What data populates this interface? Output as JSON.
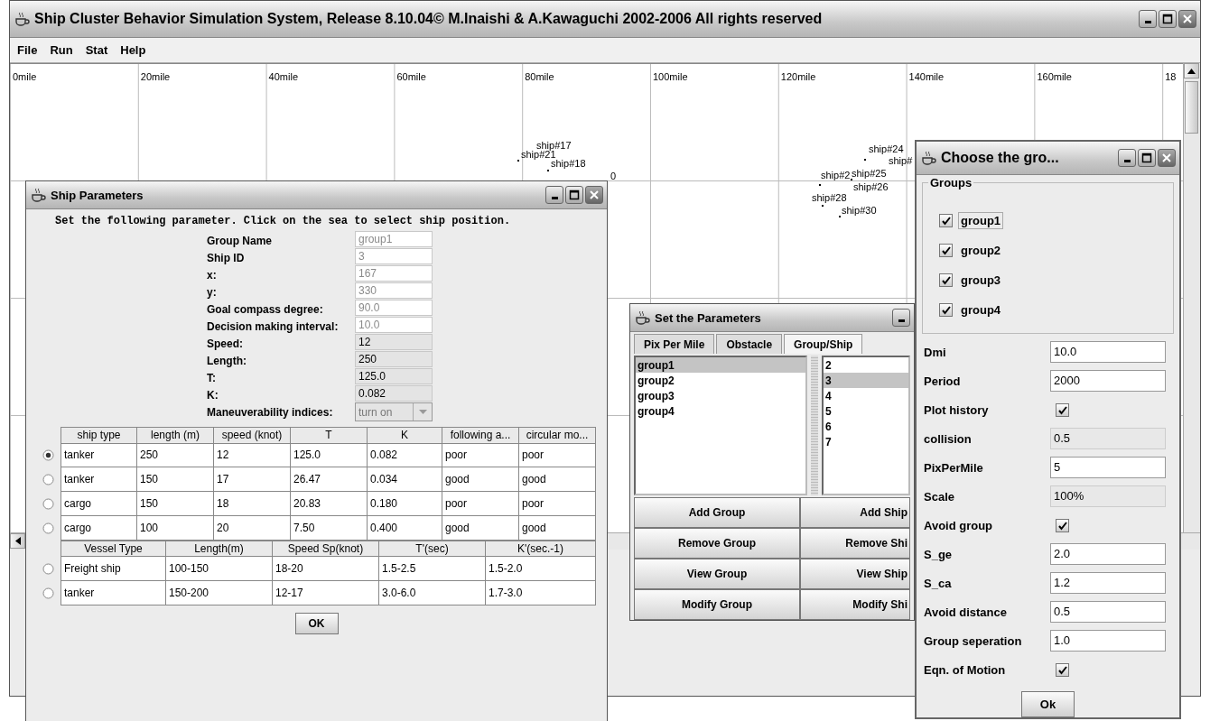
{
  "main_window": {
    "title": "Ship Cluster Behavior Simulation System, Release 8.10.04© M.Inaishi & A.Kawaguchi 2002-2006 All rights reserved",
    "menu": [
      "File",
      "Run",
      "Stat",
      "Help"
    ],
    "map": {
      "distance_labels": [
        "0mile",
        "20mile",
        "40mile",
        "60mile",
        "80mile",
        "100mile",
        "120mile",
        "140mile",
        "160mile",
        "18"
      ],
      "ships": [
        {
          "label": "ship#17"
        },
        {
          "label": "ship#21"
        },
        {
          "label": "ship#18"
        },
        {
          "label": "0"
        },
        {
          "label": "ship#24"
        },
        {
          "label": "ship#"
        },
        {
          "label": "ship#2"
        },
        {
          "label": "ship#25"
        },
        {
          "label": "ship#26"
        },
        {
          "label": "ship#28"
        },
        {
          "label": "ship#30"
        }
      ]
    }
  },
  "ship_parameters": {
    "title": "Ship Parameters",
    "instruction": "Set the following parameter. Click on the sea to select ship position.",
    "fields": [
      {
        "label": "Group Name",
        "value": "group1",
        "disabled": true
      },
      {
        "label": "Ship ID",
        "value": "3",
        "disabled": true
      },
      {
        "label": "x:",
        "value": "167",
        "disabled": true
      },
      {
        "label": "y:",
        "value": "330",
        "disabled": true
      },
      {
        "label": "Goal compass degree:",
        "value": "90.0",
        "disabled": true
      },
      {
        "label": "Decision making interval:",
        "value": "10.0",
        "disabled": true
      },
      {
        "label": "Speed:",
        "value": "12",
        "disabled": false
      },
      {
        "label": "Length:",
        "value": "250",
        "disabled": false
      },
      {
        "label": "T:",
        "value": "125.0",
        "disabled": false
      },
      {
        "label": "K:",
        "value": "0.082",
        "disabled": false
      }
    ],
    "maneuverability": {
      "label": "Maneuverability indices:",
      "value": "turn on",
      "disabled": true
    },
    "ship_table": {
      "columns": [
        "ship type",
        "length (m)",
        "speed (knot)",
        "T",
        "K",
        "following a...",
        "circular mo..."
      ],
      "rows": [
        {
          "selected": true,
          "cells": [
            "tanker",
            "250",
            "12",
            "125.0",
            "0.082",
            "poor",
            "poor"
          ]
        },
        {
          "selected": false,
          "cells": [
            "tanker",
            "150",
            "17",
            "26.47",
            "0.034",
            "good",
            "good"
          ]
        },
        {
          "selected": false,
          "cells": [
            "cargo",
            "150",
            "18",
            "20.83",
            "0.180",
            "poor",
            "poor"
          ]
        },
        {
          "selected": false,
          "cells": [
            "cargo",
            "100",
            "20",
            "7.50",
            "0.400",
            "good",
            "good"
          ]
        }
      ]
    },
    "vessel_table": {
      "columns": [
        "Vessel Type",
        "Length(m)",
        "Speed Sp(knot)",
        "T'(sec)",
        "K'(sec.-1)"
      ],
      "rows": [
        {
          "selected": false,
          "cells": [
            "Freight ship",
            "100-150",
            "18-20",
            "1.5-2.5",
            "1.5-2.0"
          ]
        },
        {
          "selected": false,
          "cells": [
            "tanker",
            "150-200",
            "12-17",
            "3.0-6.0",
            "1.7-3.0"
          ]
        }
      ]
    },
    "ok_button": "OK"
  },
  "set_parameters": {
    "title": "Set the Parameters",
    "tabs": [
      {
        "label": "Pix Per Mile",
        "selected": false
      },
      {
        "label": "Obstacle",
        "selected": false
      },
      {
        "label": "Group/Ship",
        "selected": true
      }
    ],
    "groups": [
      {
        "label": "group1",
        "selected": true
      },
      {
        "label": "group2",
        "selected": false
      },
      {
        "label": "group3",
        "selected": false
      },
      {
        "label": "group4",
        "selected": false
      }
    ],
    "ships": [
      {
        "label": "2",
        "selected": false
      },
      {
        "label": "3",
        "selected": true
      },
      {
        "label": "4",
        "selected": false
      },
      {
        "label": "5",
        "selected": false
      },
      {
        "label": "6",
        "selected": false
      },
      {
        "label": "7",
        "selected": false
      }
    ],
    "buttons": [
      "Add Group",
      "Add Ship",
      "Remove Group",
      "Remove Shi",
      "View Group",
      "View Ship",
      "Modify Group",
      "Modify Shi"
    ]
  },
  "choose_groups": {
    "title": "Choose the gro...",
    "groups_legend": "Groups",
    "groups": [
      {
        "label": "group1",
        "checked": true
      },
      {
        "label": "group2",
        "checked": true
      },
      {
        "label": "group3",
        "checked": true
      },
      {
        "label": "group4",
        "checked": true
      }
    ],
    "settings": [
      {
        "kind": "field",
        "label": "Dmi",
        "value": "10.0"
      },
      {
        "kind": "field",
        "label": "Period",
        "value": "2000"
      },
      {
        "kind": "checkbox",
        "label": "Plot history",
        "checked": true
      },
      {
        "kind": "readonly",
        "label": "collision",
        "value": "0.5"
      },
      {
        "kind": "field",
        "label": "PixPerMile",
        "value": "5"
      },
      {
        "kind": "readonly",
        "label": "Scale",
        "value": "100%"
      },
      {
        "kind": "checkbox",
        "label": "Avoid group",
        "checked": true
      },
      {
        "kind": "field",
        "label": "S_ge",
        "value": "2.0"
      },
      {
        "kind": "field",
        "label": "S_ca",
        "value": "1.2"
      },
      {
        "kind": "field",
        "label": "Avoid distance",
        "value": "0.5"
      },
      {
        "kind": "field",
        "label": "Group seperation",
        "value": "1.0"
      },
      {
        "kind": "checkbox",
        "label": "Eqn. of Motion",
        "checked": true
      }
    ],
    "ok_button": "Ok"
  }
}
